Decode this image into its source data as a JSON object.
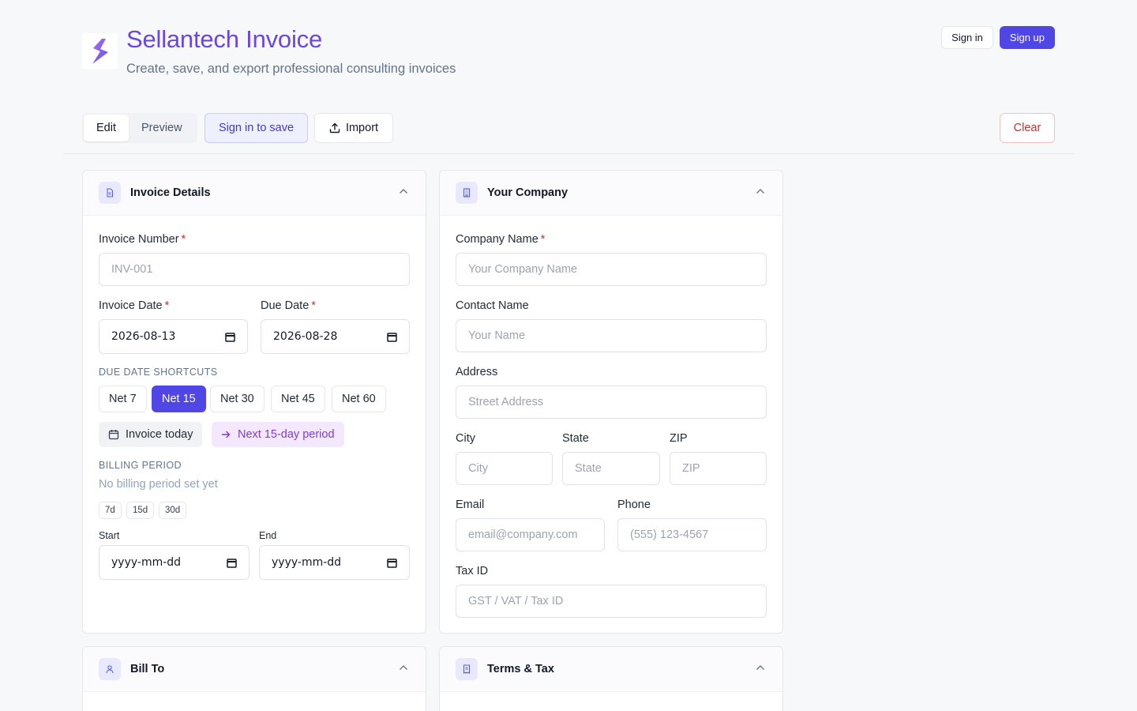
{
  "app": {
    "title": "Sellantech Invoice",
    "subtitle": "Create, save, and export professional consulting invoices",
    "sign_in": "Sign in",
    "sign_up": "Sign up"
  },
  "toolbar": {
    "tabs": [
      "Edit",
      "Preview"
    ],
    "active_tab": "Edit",
    "save": "Sign in to save",
    "import": "Import",
    "clear": "Clear"
  },
  "invoice_details": {
    "title": "Invoice Details",
    "invoice_number_label": "Invoice Number",
    "invoice_number_placeholder": "INV-001",
    "invoice_date_label": "Invoice Date",
    "invoice_date_value": "2026-08-13",
    "due_date_label": "Due Date",
    "due_date_value": "2026-08-28",
    "shortcuts_label": "DUE DATE SHORTCUTS",
    "shortcuts": [
      "Net 7",
      "Net 15",
      "Net 30",
      "Net 45",
      "Net 60"
    ],
    "active_shortcut": "Net 15",
    "invoice_today": "Invoice today",
    "next_period": "Next 15-day period",
    "billing_period_label": "BILLING PERIOD",
    "billing_period_empty": "No billing period set yet",
    "period_presets": [
      "7d",
      "15d",
      "30d"
    ],
    "start_label": "Start",
    "end_label": "End",
    "start_placeholder": "yyyy-mm-dd",
    "end_placeholder": "yyyy-mm-dd"
  },
  "your_company": {
    "title": "Your Company",
    "company_name_label": "Company Name",
    "company_name_placeholder": "Your Company Name",
    "contact_name_label": "Contact Name",
    "contact_name_placeholder": "Your Name",
    "address_label": "Address",
    "address_placeholder": "Street Address",
    "city_label": "City",
    "city_placeholder": "City",
    "state_label": "State",
    "state_placeholder": "State",
    "zip_label": "ZIP",
    "zip_placeholder": "ZIP",
    "email_label": "Email",
    "email_placeholder": "email@company.com",
    "phone_label": "Phone",
    "phone_placeholder": "(555) 123-4567",
    "tax_id_label": "Tax ID",
    "tax_id_placeholder": "GST / VAT / Tax ID"
  },
  "bill_to": {
    "title": "Bill To"
  },
  "terms_tax": {
    "title": "Terms & Tax"
  },
  "colors": {
    "accent": "#4f46e5",
    "brand_title": "#6b46e0",
    "danger": "#dc2626",
    "next_period_bg": "#f3e8ff",
    "next_period_fg": "#7e3fc5"
  },
  "icons": {
    "logo": "lightning-s-logo",
    "invoice_details": "document-icon",
    "your_company": "building-icon",
    "bill_to": "user-icon",
    "terms_tax": "receipt-icon",
    "import": "upload-icon",
    "calendar": "calendar-icon",
    "arrow": "arrow-right-icon",
    "collapse": "chevron-up-icon"
  }
}
